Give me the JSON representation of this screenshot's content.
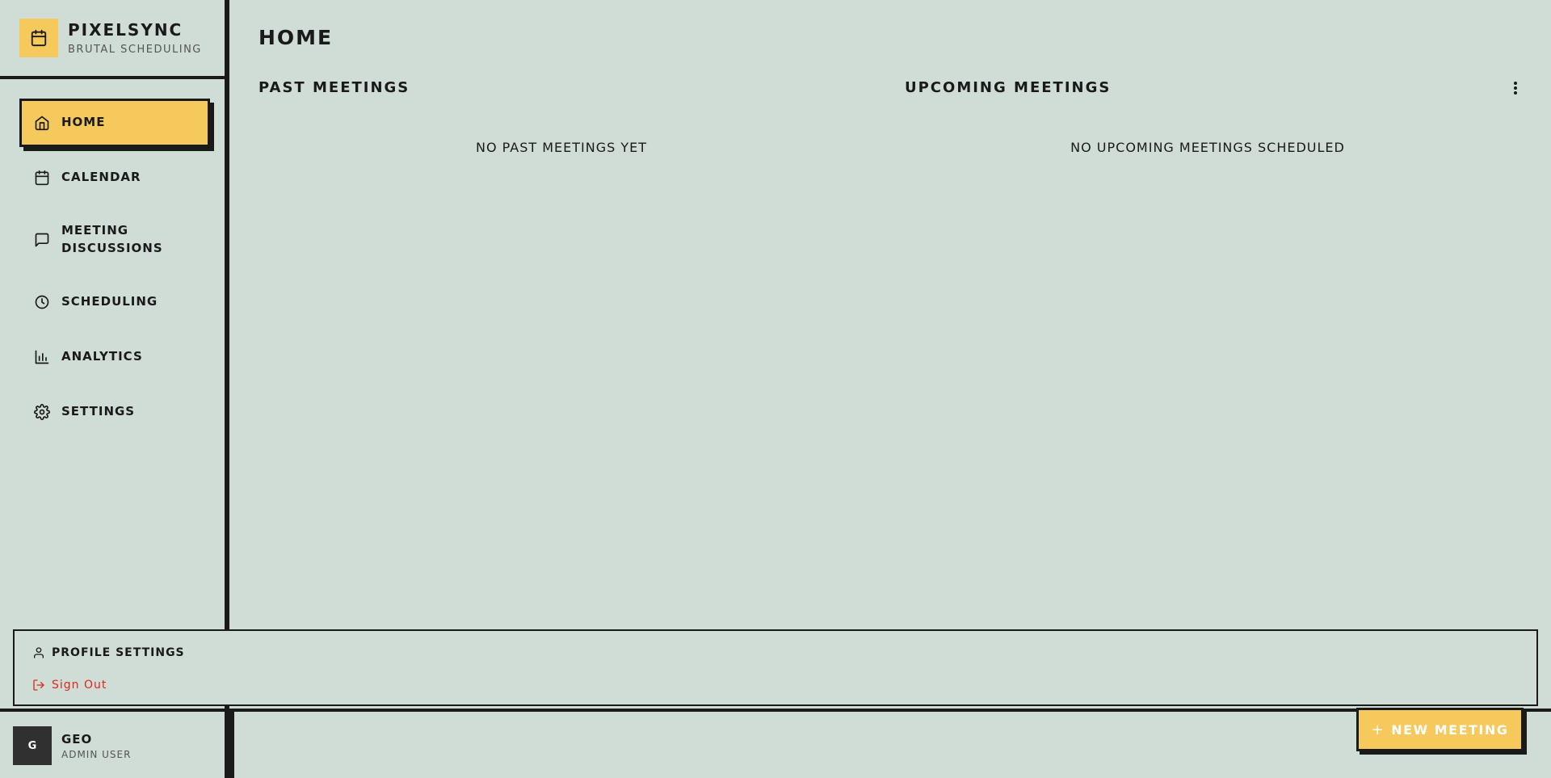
{
  "brand": {
    "name": "PIXELSYNC",
    "subtitle": "BRUTAL SCHEDULING",
    "logo_icon": "calendar-icon",
    "accent": "#f5c95b"
  },
  "sidebar": {
    "items": [
      {
        "label": "HOME",
        "icon": "home-icon",
        "active": true
      },
      {
        "label": "CALENDAR",
        "icon": "calendar-icon",
        "active": false
      },
      {
        "label_line1": "MEETING",
        "label_line2": "DISCUSSIONS",
        "icon": "message-icon",
        "active": false
      },
      {
        "label": "SCHEDULING",
        "icon": "clock-icon",
        "active": false
      },
      {
        "label": "ANALYTICS",
        "icon": "bar-chart-icon",
        "active": false
      },
      {
        "label": "SETTINGS",
        "icon": "gear-icon",
        "active": false
      }
    ]
  },
  "main": {
    "title": "HOME",
    "past": {
      "title": "PAST MEETINGS",
      "empty_text": "NO PAST MEETINGS YET"
    },
    "upcoming": {
      "title": "UPCOMING MEETINGS",
      "empty_text": "NO UPCOMING MEETINGS SCHEDULED"
    }
  },
  "popover": {
    "profile_label": "PROFILE SETTINGS",
    "signout_label": "Sign Out",
    "signout_color": "#d9291f"
  },
  "user": {
    "initial": "G",
    "name": "GEO",
    "role": "ADMIN USER"
  },
  "actions": {
    "new_meeting_label": "NEW MEETING",
    "new_meeting_icon": "plus-icon"
  }
}
